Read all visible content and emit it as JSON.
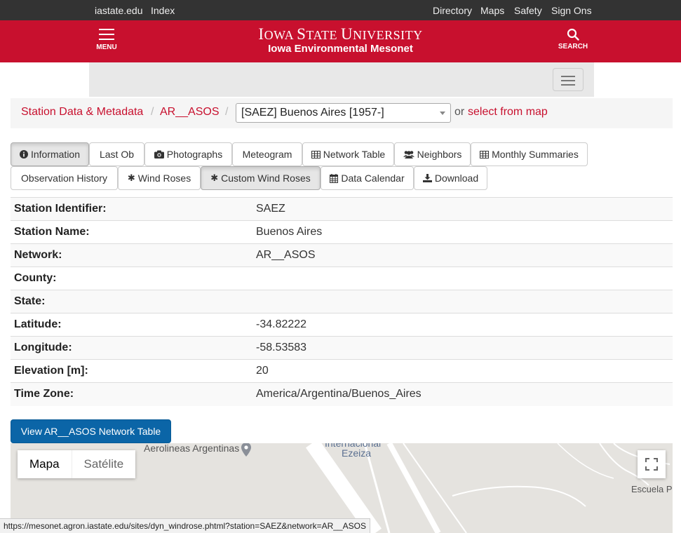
{
  "util_nav": {
    "iastate": "iastate.edu",
    "index": "Index",
    "directory": "Directory",
    "maps": "Maps",
    "safety": "Safety",
    "signons": "Sign Ons"
  },
  "header": {
    "menu_label": "MENU",
    "university_first": "I",
    "university_rest1": "OWA ",
    "university_s": "S",
    "university_rest2": "TATE ",
    "university_u": "U",
    "university_rest3": "NIVERSITY",
    "site_name": "Iowa Environmental Mesonet",
    "search_label": "SEARCH",
    "brand_color": "#c8102e"
  },
  "breadcrumb": {
    "item1": "Station Data & Metadata",
    "item2": "AR__ASOS",
    "sep": "/",
    "station_selected": "[SAEZ] Buenos Aires [1957-]",
    "or": "or",
    "map_link": "select from map"
  },
  "tabs": {
    "information": "Information",
    "last_ob": "Last Ob",
    "photographs": "Photographs",
    "meteogram": "Meteogram",
    "network_table": "Network Table",
    "neighbors": "Neighbors",
    "monthly_summaries": "Monthly Summaries",
    "obs_history": "Observation History",
    "wind_roses": "Wind Roses",
    "custom_wind_roses": "Custom Wind Roses",
    "data_calendar": "Data Calendar",
    "download": "Download"
  },
  "station_info": [
    {
      "key": "Station Identifier:",
      "value": "SAEZ"
    },
    {
      "key": "Station Name:",
      "value": "Buenos Aires"
    },
    {
      "key": "Network:",
      "value": "AR__ASOS"
    },
    {
      "key": "County:",
      "value": ""
    },
    {
      "key": "State:",
      "value": ""
    },
    {
      "key": "Latitude:",
      "value": "-34.82222"
    },
    {
      "key": "Longitude:",
      "value": "-58.53583"
    },
    {
      "key": "Elevation [m]:",
      "value": "20"
    },
    {
      "key": "Time Zone:",
      "value": "America/Argentina/Buenos_Aires"
    }
  ],
  "network_button": "View AR__ASOS Network Table",
  "map": {
    "type_map": "Mapa",
    "type_satellite": "Satélite",
    "label_airline": "Aerolineas Argentinas",
    "label_airport1": "Internacional",
    "label_airport2": "Ezeiza",
    "label_school": "Escuela P"
  },
  "status_url": "https://mesonet.agron.iastate.edu/sites/dyn_windrose.phtml?station=SAEZ&network=AR__ASOS"
}
